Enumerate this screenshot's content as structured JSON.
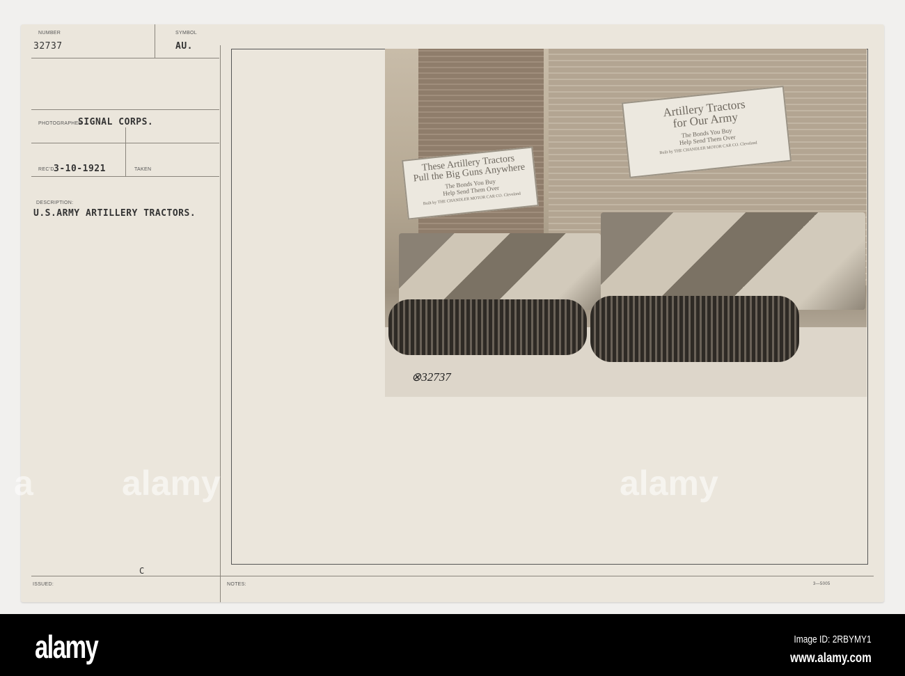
{
  "card": {
    "number_label": "NUMBER",
    "number": "32737",
    "symbol_label": "SYMBOL",
    "symbol": "AU.",
    "photographer_label": "PHOTOGRAPHER",
    "photographer": "SIGNAL CORPS.",
    "received_label": "REC'D",
    "received": "3-10-1921",
    "taken_label": "TAKEN",
    "description_label": "DESCRIPTION:",
    "description": "U.S.ARMY ARTILLERY TRACTORS.",
    "issued_label": "ISSUED:",
    "issued_mark": "C",
    "notes_label": "NOTES:",
    "form_number": "3—5005"
  },
  "photo": {
    "sign_left": {
      "headline1": "These Artillery Tractors",
      "headline2": "Pull the Big Guns Anywhere",
      "line1": "The Bonds You Buy",
      "line2": "Help Send Them Over",
      "builder": "Built by THE CHANDLER MOTOR CAR CO. Cleveland"
    },
    "sign_right": {
      "headline1": "Artillery Tractors",
      "headline2": "for Our Army",
      "line1": "The Bonds You Buy",
      "line2": "Help Send Them Over",
      "builder": "Built by THE CHANDLER MOTOR CAR CO. Cleveland"
    },
    "negative_number": "⊗32737"
  },
  "footer": {
    "logo": "alamy",
    "image_id": "Image ID: 2RBYMY1",
    "url": "www.alamy.com"
  }
}
